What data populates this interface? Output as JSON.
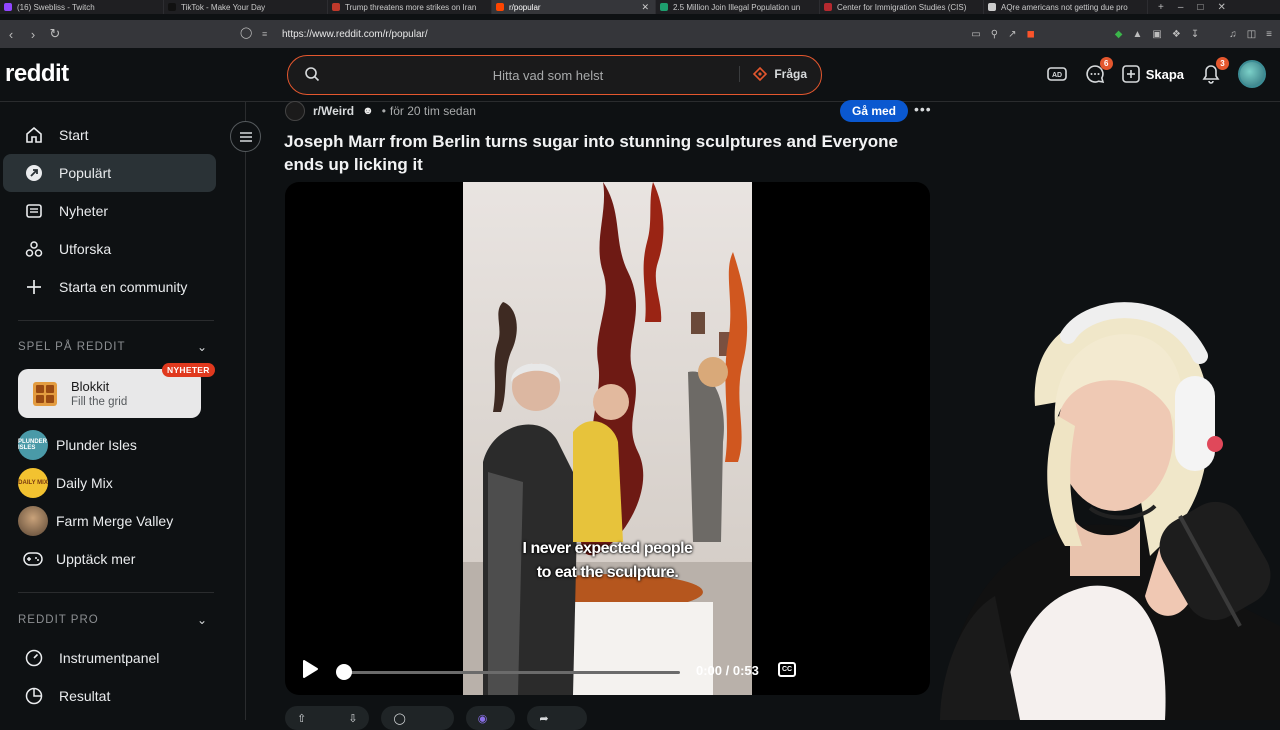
{
  "browser": {
    "tabs": [
      {
        "label": "(16) Swebliss - Twitch",
        "color": "#9146ff",
        "active": false
      },
      {
        "label": "TikTok - Make Your Day",
        "color": "#111111",
        "active": false
      },
      {
        "label": "Trump threatens more strikes on Iran",
        "color": "#c0392b",
        "active": false
      },
      {
        "label": "r/popular",
        "color": "#ff4500",
        "active": true
      },
      {
        "label": "2.5 Million Join Illegal Population un",
        "color": "#1e9e6e",
        "active": false
      },
      {
        "label": "Center for Immigration Studies (CIS)",
        "color": "#b5292f",
        "active": false
      },
      {
        "label": "AQre americans not getting due pro",
        "color": "#cccccc",
        "active": false
      }
    ],
    "url": "https://www.reddit.com/r/popular/"
  },
  "header": {
    "logo": "reddit",
    "search_placeholder": "Hitta vad som helst",
    "ask_label": "Fråga",
    "chat_badge": "6",
    "create_label": "Skapa",
    "notif_badge": "3"
  },
  "sidebar": {
    "nav": [
      {
        "label": "Start",
        "icon": "home-icon"
      },
      {
        "label": "Populärt",
        "icon": "popular-icon"
      },
      {
        "label": "Nyheter",
        "icon": "news-icon"
      },
      {
        "label": "Utforska",
        "icon": "explore-icon"
      },
      {
        "label": "Starta en community",
        "icon": "plus-icon"
      }
    ],
    "games_header": "SPEL PÅ REDDIT",
    "featured_game": {
      "name": "Blokkit",
      "subtitle": "Fill the grid",
      "badge": "NYHETER"
    },
    "games": [
      {
        "label": "Plunder Isles",
        "icon_text": "PLUNDER ISLES",
        "color": "#4a9aa8"
      },
      {
        "label": "Daily Mix",
        "icon_text": "DAILY MIX",
        "color": "#f2c230"
      },
      {
        "label": "Farm Merge Valley",
        "icon_text": "",
        "color": "#6f5a44"
      }
    ],
    "discover_label": "Upptäck mer",
    "pro_header": "REDDIT PRO",
    "pro_items": [
      {
        "label": "Instrumentpanel",
        "icon": "dashboard-icon"
      },
      {
        "label": "Resultat",
        "icon": "results-icon"
      }
    ]
  },
  "post": {
    "subreddit": "r/Weird",
    "time": "för 20 tim sedan",
    "join_label": "Gå med",
    "title": "Joseph Marr from Berlin turns sugar into stunning sculptures and Everyone ends up licking it",
    "subtitle_line1": "I never expected people",
    "subtitle_line2": "to eat the sculpture.",
    "time_display": "0:00 / 0:53",
    "progress": 0,
    "cc_label": "CC"
  },
  "colors": {
    "accent": "#e4572e",
    "join_blue": "#0a58d0",
    "background": "#0e1113"
  }
}
